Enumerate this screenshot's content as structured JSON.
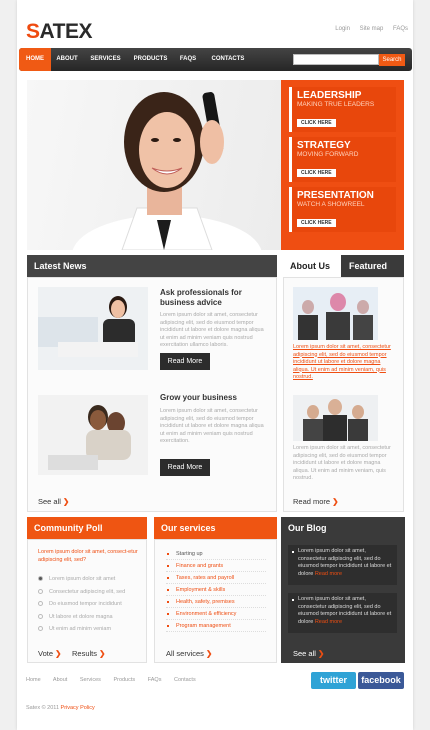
{
  "header": {
    "logo_s": "S",
    "logo_rest": "ATEX",
    "links": [
      "Login",
      "Site map",
      "FAQs"
    ]
  },
  "nav": {
    "items": [
      "HOME",
      "ABOUT",
      "SERVICES",
      "PRODUCTS",
      "FAQS",
      "CONTACTS"
    ],
    "search_button": "Search",
    "search_value": ""
  },
  "promo": [
    {
      "title": "LEADERSHIP",
      "sub": "MAKING TRUE LEADERS",
      "btn": "CLICK HERE"
    },
    {
      "title": "STRATEGY",
      "sub": "MOVING FORWARD",
      "btn": "CLICK HERE"
    },
    {
      "title": "PRESENTATION",
      "sub": "WATCH A SHOWREEL",
      "btn": "CLICK HERE"
    }
  ],
  "news": {
    "title": "Latest News",
    "items": [
      {
        "title": "Ask professionals for business advice",
        "text": "Lorem ipsum dolor sit amet, consectetur adipiscing elit, sed do eiusmod tempor incididunt ut labore et dolore magna aliqua ut enim ad minim veniam quis nostrud exercitation ullamco laboris.",
        "btn": "Read More"
      },
      {
        "title": "Grow your business",
        "text": "Lorem ipsum dolor sit amet, consectetur adipiscing elit, sed do eiusmod tempor incididunt ut labore et dolore magna aliqua ut enim ad minim veniam quis nostrud exercitation.",
        "btn": "Read More"
      }
    ],
    "see_all": "See all"
  },
  "about": {
    "tab_about": "About Us",
    "tab_featured": "Featured",
    "link_text": "Lorem ipsum dolor sit amet, consectetur adipiscing elit, sed do eiusmod tempor incididunt ut labore et dolore magna aliqua. Ut enim ad minim veniam, quis nostrud.",
    "text": "Lorem ipsum dolor sit amet, consectetur adipiscing elit, sed do eiusmod tempor incididunt ut labore et dolore magna aliqua. Ut enim ad minim veniam, quis nostrud.",
    "more": "Read more"
  },
  "poll": {
    "title": "Community Poll",
    "question": "Lorem ipsum dolor sit amet, consect-etur adipiscing elit, sed?",
    "options": [
      "Lorem ipsum dolor sit amet",
      "Consectetur adipiscing elit, sed",
      "Do eiusmod tempor incididunt",
      "Ut labore et dolore magna",
      "Ut enim ad minim veniam"
    ],
    "vote": "Vote",
    "results": "Results"
  },
  "services": {
    "title": "Our services",
    "items": [
      "Starting up",
      "Finance and grants",
      "Taxes, rates and payroll",
      "Employment & skills",
      "Health, safety, premises",
      "Environment & efficiency",
      "Program management"
    ],
    "all": "All services"
  },
  "blog": {
    "title": "Our Blog",
    "posts": [
      {
        "text": "Lorem ipsum dolor sit amet, consectetur adipiscing elit, sed do eiusmod tempor incididunt ut labore et dolore",
        "more": "Read more"
      },
      {
        "text": "Lorem ipsum dolor sit amet, consectetur adipiscing elit, sed do eiusmod tempor incididunt ut labore et dolore",
        "more": "Read more"
      }
    ],
    "see_all": "See all"
  },
  "footer": {
    "links": [
      "Home",
      "About",
      "Services",
      "Products",
      "FAQs",
      "Contacts"
    ],
    "copyright": "Satex © 2011",
    "privacy": "Privacy Policy"
  },
  "social": {
    "twitter": "twitter",
    "facebook": "facebook"
  }
}
